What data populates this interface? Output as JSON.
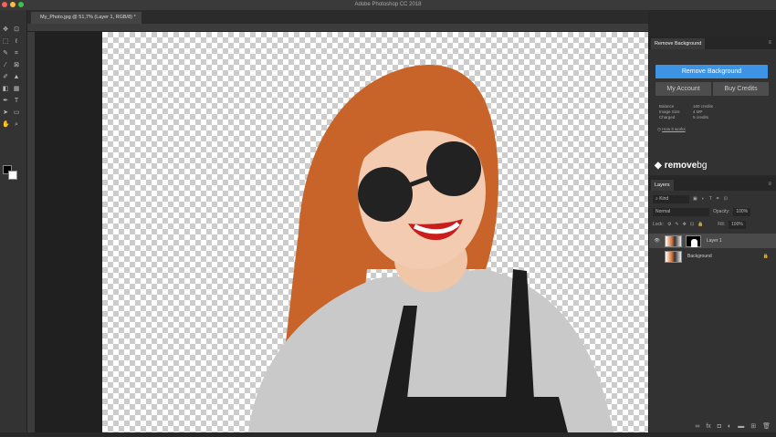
{
  "app": {
    "title": "Adobe Photoshop CC 2018"
  },
  "document": {
    "tab_label": "My_Photo.jpg @ 51,7% (Layer 1, RGB/8) *"
  },
  "remove_bg": {
    "panel_title": "Remove Background",
    "remove_button": "Remove Background",
    "account_button": "My Account",
    "credits_button": "Buy Credits",
    "info": [
      {
        "label": "Balance",
        "value": "160 credits"
      },
      {
        "label": "Image Size",
        "value": "4 MP"
      },
      {
        "label": "Charged",
        "value": "5 credits"
      }
    ],
    "help_link": "How it works",
    "logo_text": "remove",
    "logo_text2": "bg"
  },
  "layers": {
    "panel_title": "Layers",
    "filter": "Kind",
    "blend_mode": "Normal",
    "opacity_label": "Opacity:",
    "opacity": "100%",
    "lock_label": "Lock:",
    "fill_label": "Fill:",
    "fill": "100%",
    "items": [
      {
        "name": "Layer 1"
      },
      {
        "name": "Background"
      }
    ]
  },
  "colors": {
    "accent": "#3d94e4"
  }
}
